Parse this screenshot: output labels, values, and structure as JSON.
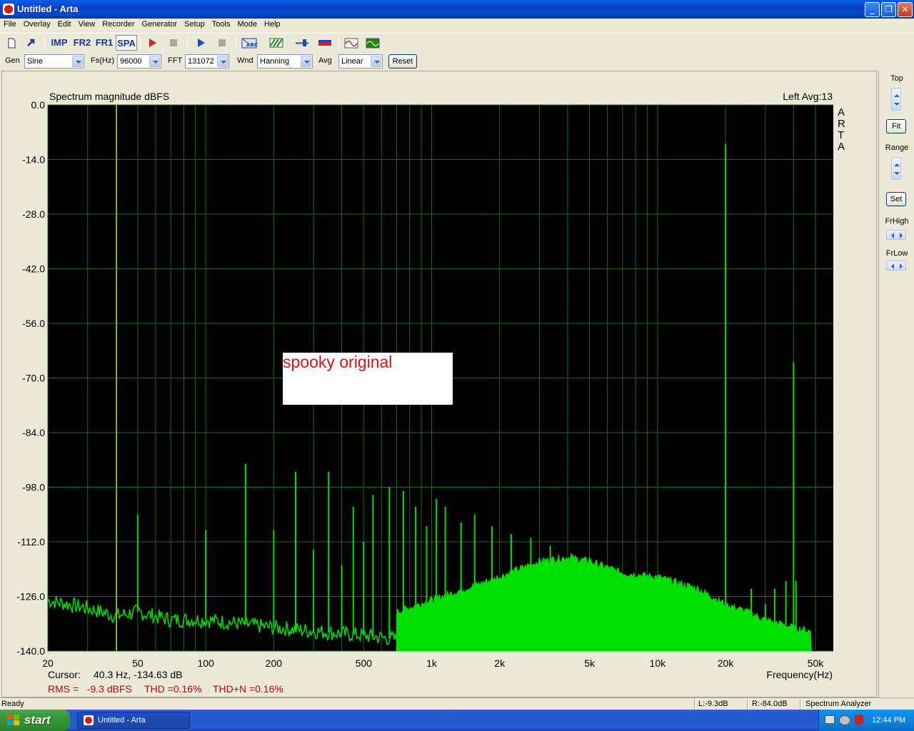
{
  "window": {
    "title": "Untitled - Arta"
  },
  "menu": [
    "File",
    "Overlay",
    "Edit",
    "View",
    "Recorder",
    "Generator",
    "Setup",
    "Tools",
    "Mode",
    "Help"
  ],
  "toolbar": {
    "imp_label": "IMP",
    "fr2_label": "FR2",
    "fr1_label": "FR1",
    "spa_label": "SPA"
  },
  "controls": {
    "gen_label": "Gen",
    "gen_value": "Sine",
    "fs_label": "Fs(Hz)",
    "fs_value": "96000",
    "fft_label": "FFT",
    "fft_value": "131072",
    "wnd_label": "Wnd",
    "wnd_value": "Hanning",
    "avg_label": "Avg",
    "avg_value": "Linear",
    "reset_label": "Reset"
  },
  "plot_header": {
    "left_info": "Left  Avg:13",
    "watermark": "ARTA"
  },
  "annotation_box": "spooky original",
  "readouts": {
    "cursor_label": "Cursor:",
    "cursor_value": "40.3 Hz, -134.63 dB",
    "rms": "RMS =   -9.3 dBFS",
    "thd": "THD =0.16%",
    "thdn": "THD+N =0.16%"
  },
  "right_panel": {
    "top": "Top",
    "fit": "Fit",
    "range": "Range",
    "set": "Set",
    "frhigh": "FrHigh",
    "frlow": "FrLow"
  },
  "status": {
    "ready": "Ready",
    "level_l": "L:-9.3dB",
    "level_r": "R:-84.0dB",
    "mode": "Spectrum Analyzer"
  },
  "taskbar": {
    "start": "start",
    "task_item": "Untitled - Arta",
    "clock": "12:44 PM"
  },
  "colors": {
    "plot_bg": "#000000",
    "grid": "#1a6a1a",
    "trace": "#00e000",
    "cursor": "#a0c040",
    "axis_text": "#000000",
    "readout_red": "#c00000"
  },
  "chart_data": {
    "type": "line",
    "title": "Spectrum magnitude dBFS",
    "xlabel": "Frequency(Hz)",
    "ylabel": "",
    "xscale": "log",
    "xlim": [
      20,
      60000
    ],
    "ylim": [
      -140,
      0
    ],
    "y_ticks": [
      "0.0",
      "-14.0",
      "-28.0",
      "-42.0",
      "-56.0",
      "-70.0",
      "-84.0",
      "-98.0",
      "-112.0",
      "-126.0",
      "-140.0"
    ],
    "x_ticks": [
      {
        "value": 20,
        "label": "20"
      },
      {
        "value": 50,
        "label": "50"
      },
      {
        "value": 100,
        "label": "100"
      },
      {
        "value": 200,
        "label": "200"
      },
      {
        "value": 500,
        "label": "500"
      },
      {
        "value": 1000,
        "label": "1k"
      },
      {
        "value": 2000,
        "label": "2k"
      },
      {
        "value": 5000,
        "label": "5k"
      },
      {
        "value": 10000,
        "label": "10k"
      },
      {
        "value": 20000,
        "label": "20k"
      },
      {
        "value": 50000,
        "label": "50k"
      }
    ],
    "cursor_hz": 40.3,
    "grid": true,
    "series": [
      {
        "peaks": [
          {
            "x": 50,
            "y": -105
          },
          {
            "x": 100,
            "y": -109
          },
          {
            "x": 150,
            "y": -92
          },
          {
            "x": 200,
            "y": -109
          },
          {
            "x": 250,
            "y": -94
          },
          {
            "x": 300,
            "y": -114
          },
          {
            "x": 350,
            "y": -94
          },
          {
            "x": 400,
            "y": -118
          },
          {
            "x": 450,
            "y": -103
          },
          {
            "x": 500,
            "y": -112
          },
          {
            "x": 550,
            "y": -100
          },
          {
            "x": 650,
            "y": -98
          },
          {
            "x": 750,
            "y": -99
          },
          {
            "x": 850,
            "y": -103
          },
          {
            "x": 950,
            "y": -108
          },
          {
            "x": 1050,
            "y": -101
          },
          {
            "x": 1150,
            "y": -103
          },
          {
            "x": 1350,
            "y": -107
          },
          {
            "x": 1550,
            "y": -105
          },
          {
            "x": 1850,
            "y": -108
          },
          {
            "x": 2250,
            "y": -110
          },
          {
            "x": 2750,
            "y": -111
          },
          {
            "x": 3350,
            "y": -113
          },
          {
            "x": 4150,
            "y": -115
          },
          {
            "x": 5000,
            "y": -116
          },
          {
            "x": 20000,
            "y": -10
          },
          {
            "x": 40000,
            "y": -66
          },
          {
            "x": 26000,
            "y": -124
          },
          {
            "x": 30000,
            "y": -128
          },
          {
            "x": 33000,
            "y": -124
          },
          {
            "x": 37000,
            "y": -122
          },
          {
            "x": 41000,
            "y": -122
          }
        ],
        "floor": [
          {
            "x": 20,
            "y": -127
          },
          {
            "x": 30,
            "y": -129
          },
          {
            "x": 40,
            "y": -131
          },
          {
            "x": 50,
            "y": -130
          },
          {
            "x": 70,
            "y": -132
          },
          {
            "x": 100,
            "y": -132
          },
          {
            "x": 200,
            "y": -134
          },
          {
            "x": 500,
            "y": -136
          },
          {
            "x": 700,
            "y": -137
          }
        ],
        "envelope": [
          {
            "x": 700,
            "y": -130
          },
          {
            "x": 1000,
            "y": -127
          },
          {
            "x": 2000,
            "y": -121
          },
          {
            "x": 3000,
            "y": -117
          },
          {
            "x": 4000,
            "y": -116
          },
          {
            "x": 5000,
            "y": -117
          },
          {
            "x": 7000,
            "y": -120
          },
          {
            "x": 10000,
            "y": -121
          },
          {
            "x": 15000,
            "y": -124
          },
          {
            "x": 20000,
            "y": -128
          },
          {
            "x": 25000,
            "y": -130
          },
          {
            "x": 30000,
            "y": -132
          },
          {
            "x": 40000,
            "y": -134
          },
          {
            "x": 48000,
            "y": -135
          }
        ]
      }
    ]
  }
}
